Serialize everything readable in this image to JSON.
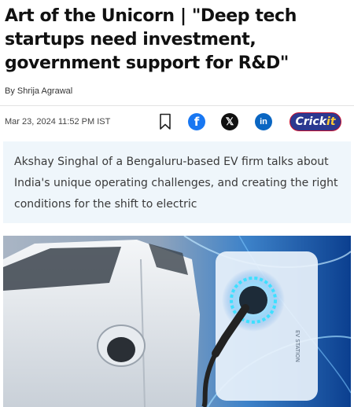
{
  "article": {
    "title": "Art of the Unicorn | \"Deep tech startups need investment, government support for R&D\"",
    "byline_prefix": "By ",
    "author": "Shrija Agrawal",
    "date": "Mar 23, 2024 11:52 PM IST",
    "summary": "Akshay Singhal of a Bengaluru-based EV firm talks about India's unique operating challenges, and creating the right conditions for the shift to electric"
  },
  "share": {
    "bookmark_icon": "bookmark-icon",
    "facebook_glyph": "f",
    "x_glyph": "𝕏",
    "linkedin_glyph": "in",
    "crick_main": "Crick",
    "crick_suffix": "it"
  },
  "hero": {
    "station_label": "EV STATION"
  },
  "colors": {
    "facebook": "#1877f2",
    "x": "#111111",
    "linkedin": "#0a66c2",
    "crickit_bg": "#2b3990",
    "summary_bg": "#eff6fb"
  }
}
